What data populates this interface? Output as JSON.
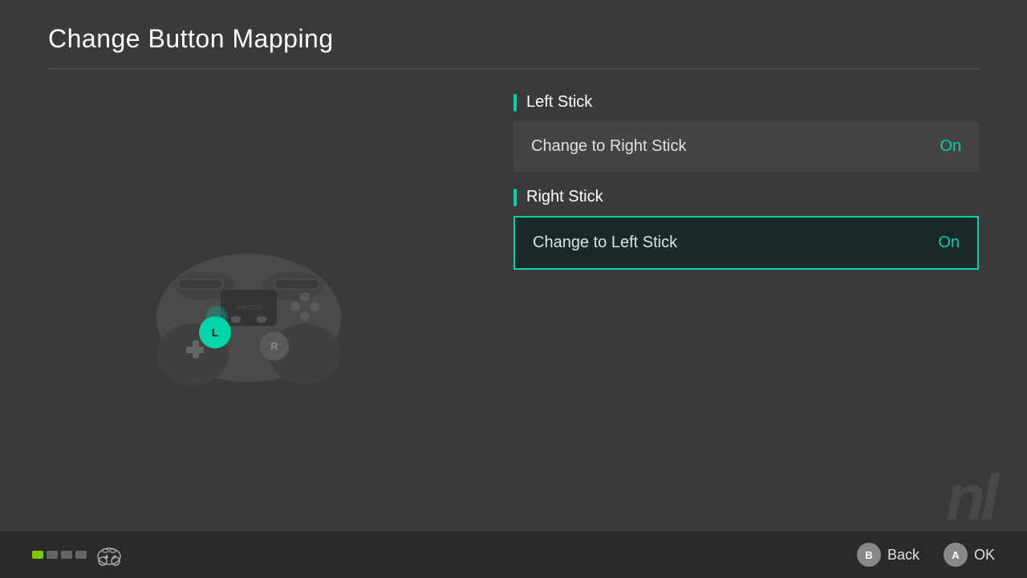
{
  "header": {
    "title": "Change Button Mapping"
  },
  "left_stick_section": {
    "title": "Left Stick",
    "options": [
      {
        "label": "Change to Right Stick",
        "value": "On",
        "selected": false
      }
    ]
  },
  "right_stick_section": {
    "title": "Right Stick",
    "options": [
      {
        "label": "Change to Left Stick",
        "value": "On",
        "selected": true
      }
    ]
  },
  "bottom_bar": {
    "back_label": "Back",
    "ok_label": "OK",
    "b_button": "B",
    "a_button": "A"
  },
  "watermark": "nl",
  "colors": {
    "accent": "#00d4aa",
    "selected_border": "#00d4aa",
    "dot_active": "#7dc800"
  }
}
